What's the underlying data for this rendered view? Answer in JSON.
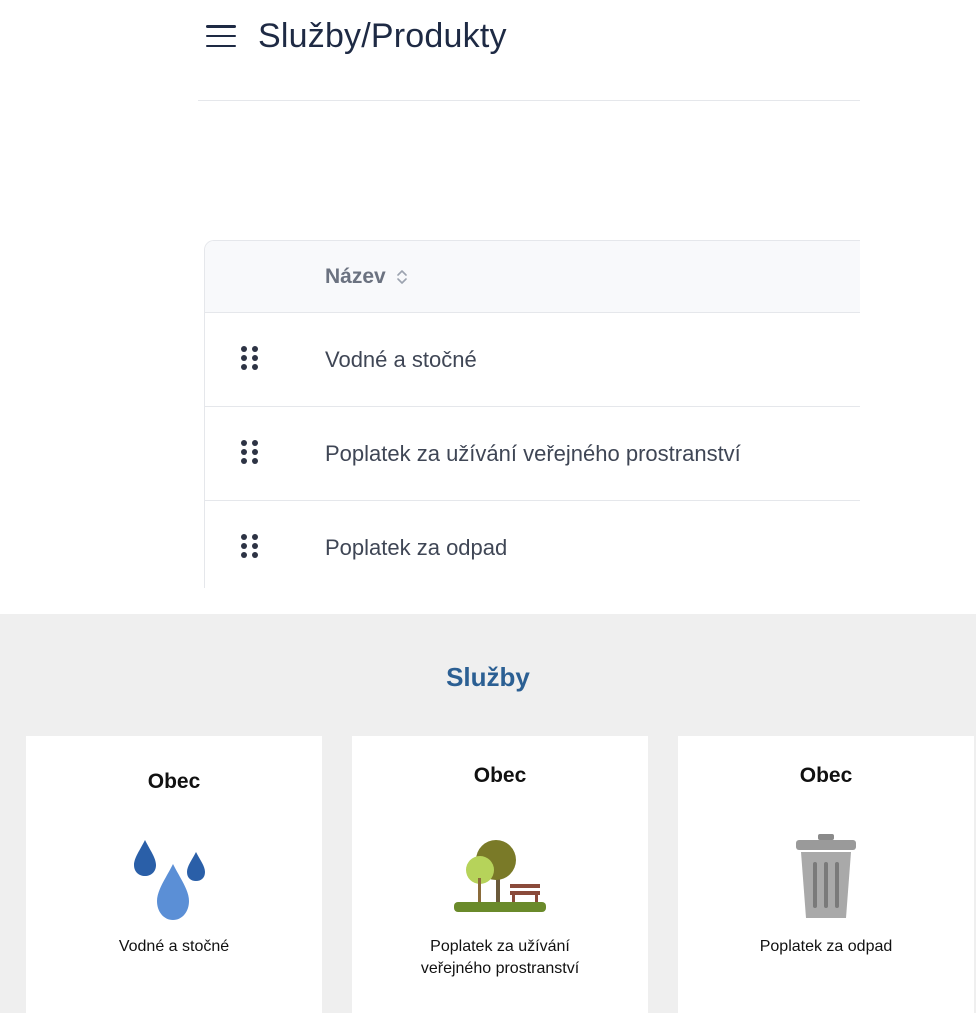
{
  "header": {
    "title": "Služby/Produkty"
  },
  "table": {
    "columns": [
      {
        "label": "Název"
      }
    ],
    "rows": [
      {
        "name": "Vodné a stočné"
      },
      {
        "name": "Poplatek za užívání veřejného prostranství"
      },
      {
        "name": "Poplatek za odpad"
      }
    ]
  },
  "public": {
    "title": "Služby",
    "cards": [
      {
        "org": "Obec",
        "icon": "water-drops-icon",
        "label_lines": [
          "Vodné a stočné"
        ]
      },
      {
        "org": "Obec",
        "icon": "park-bench-icon",
        "label_lines": [
          "Poplatek za užívání",
          "veřejného prostranství"
        ]
      },
      {
        "org": "Obec",
        "icon": "trash-bin-icon",
        "label_lines": [
          "Poplatek za odpad"
        ]
      }
    ]
  },
  "colors": {
    "navy_text": "#1e2a44",
    "muted_header": "#6b7280",
    "public_title": "#2b5f93",
    "public_background": "#efefef"
  }
}
